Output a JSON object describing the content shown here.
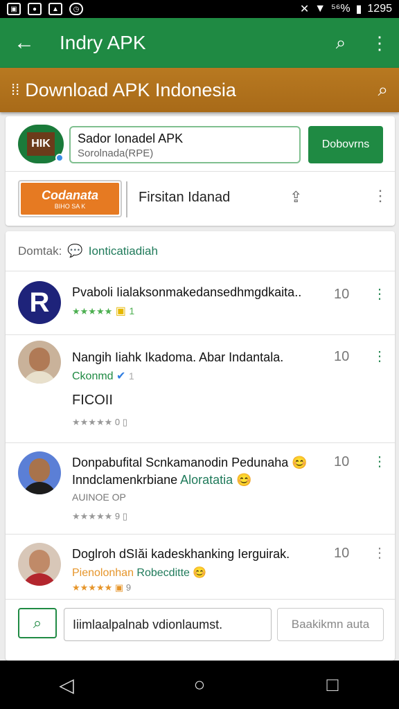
{
  "status_bar": {
    "left_icons": [
      "sim-icon",
      "photo-icon",
      "image-icon",
      "clock-icon"
    ],
    "signal_text": "ℕ",
    "battery_text": "⁵⁶%",
    "time": "1295"
  },
  "app_bar": {
    "title": "Indry APK"
  },
  "banner": {
    "title": "Download APK Indonesia"
  },
  "app_card": {
    "icon_text": "HIK",
    "name": "Sador Ionadel APK",
    "subtitle": "Sorolnada(RPE)",
    "download_label": "Dobovrns",
    "badge_title": "Codanata",
    "badge_subtitle": "BIHO SA K",
    "secondary_label": "Firsitan Idanad"
  },
  "reviews_section": {
    "label": "Domtak:",
    "value": "Ionticatiadiah",
    "reviews": [
      {
        "avatar": "R",
        "title": "Pvaboli Iialaksonmakedansedhmgdkaita..",
        "stars": "★★★★★",
        "meta": "1",
        "score": "10"
      },
      {
        "title": "Nangih Iiahk Ikadoma. Abar Indantala.",
        "subtitle": "Ckonmd",
        "meta": "1",
        "extra": "FICOII",
        "stars": "★★★★★",
        "meta2": "0",
        "score": "10"
      },
      {
        "title": "Donpabufital Scnkamanodin Pedunaha 😊",
        "title2": "Inndclamenkrbiane",
        "title2_tag": "Aloratatia 😊",
        "subtitle": "AUINOE OP",
        "stars": "★★★★★",
        "meta": "9",
        "score": "10"
      },
      {
        "title": "Doglroh dSIăi kadeskhanking Ierguirak.",
        "subtitle": "Pienolonhan",
        "subtitle_tag": "Robecditte 😊",
        "stars": "★★★★★",
        "meta": "9",
        "score": "10"
      }
    ]
  },
  "composer": {
    "value": "Iiimlaalpalnab vdionlaumst.",
    "button_label": "Baakikmn auta"
  },
  "nav_bar": {
    "back": "◁",
    "home": "○",
    "recents": "□"
  }
}
